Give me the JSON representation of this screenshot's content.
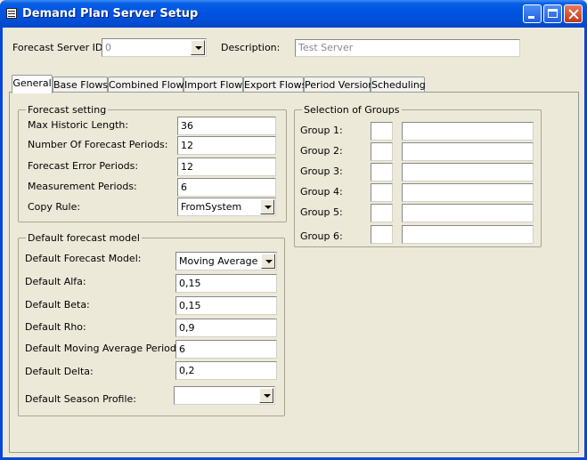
{
  "window": {
    "title": "Demand Plan Server Setup"
  },
  "header": {
    "server_id_label": "Forecast Server ID:",
    "server_id_value": "0",
    "description_label": "Description:",
    "description_value": "Test Server"
  },
  "tabs": [
    {
      "label": "General",
      "active": true
    },
    {
      "label": "Base Flows"
    },
    {
      "label": "Combined Flows"
    },
    {
      "label": "Import Flows"
    },
    {
      "label": "Export Flows"
    },
    {
      "label": "Period Version"
    },
    {
      "label": "Scheduling"
    }
  ],
  "forecast_setting": {
    "title": "Forecast setting",
    "rows": [
      {
        "label": "Max Historic Length:",
        "value": "36"
      },
      {
        "label": "Number Of Forecast Periods:",
        "value": "12"
      },
      {
        "label": "Forecast Error Periods:",
        "value": "12"
      },
      {
        "label": "Measurement Periods:",
        "value": "6"
      },
      {
        "label": "Copy Rule:",
        "value": "FromSystem"
      }
    ]
  },
  "default_model": {
    "title": "Default forecast model",
    "rows": [
      {
        "label": "Default Forecast Model:",
        "value": "Moving Average"
      },
      {
        "label": "Default Alfa:",
        "value": "0,15"
      },
      {
        "label": "Default Beta:",
        "value": "0,15"
      },
      {
        "label": "Default Rho:",
        "value": "0,9"
      },
      {
        "label": "Default Moving Average Periods:",
        "value": "6"
      },
      {
        "label": "Default Delta:",
        "value": "0,2"
      },
      {
        "label": "Default Season Profile:",
        "value": ""
      }
    ]
  },
  "groups": {
    "title": "Selection of Groups",
    "rows": [
      {
        "label": "Group 1:",
        "code": "",
        "name": ""
      },
      {
        "label": "Group 2:",
        "code": "",
        "name": ""
      },
      {
        "label": "Group 3:",
        "code": "",
        "name": ""
      },
      {
        "label": "Group 4:",
        "code": "",
        "name": ""
      },
      {
        "label": "Group 5:",
        "code": "",
        "name": ""
      },
      {
        "label": "Group 6:",
        "code": "",
        "name": ""
      }
    ]
  },
  "colors": {
    "titlebar": "#0054e3",
    "face": "#ece9d8",
    "tab_border": "#919b9c"
  }
}
